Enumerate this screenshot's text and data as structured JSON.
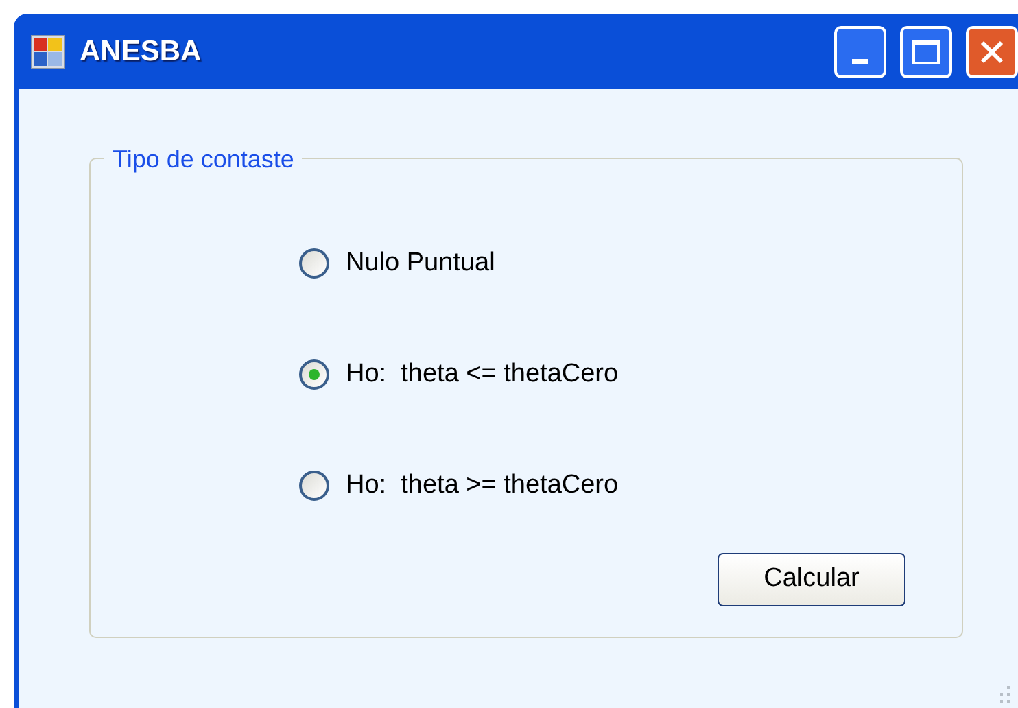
{
  "window": {
    "title": "ANESBA"
  },
  "group": {
    "title": "Tipo de contaste",
    "options": [
      {
        "label": "Nulo Puntual",
        "selected": false
      },
      {
        "label": "Ho:  theta <= thetaCero",
        "selected": true
      },
      {
        "label": "Ho:  theta >= thetaCero",
        "selected": false
      }
    ],
    "button": "Calcular"
  }
}
